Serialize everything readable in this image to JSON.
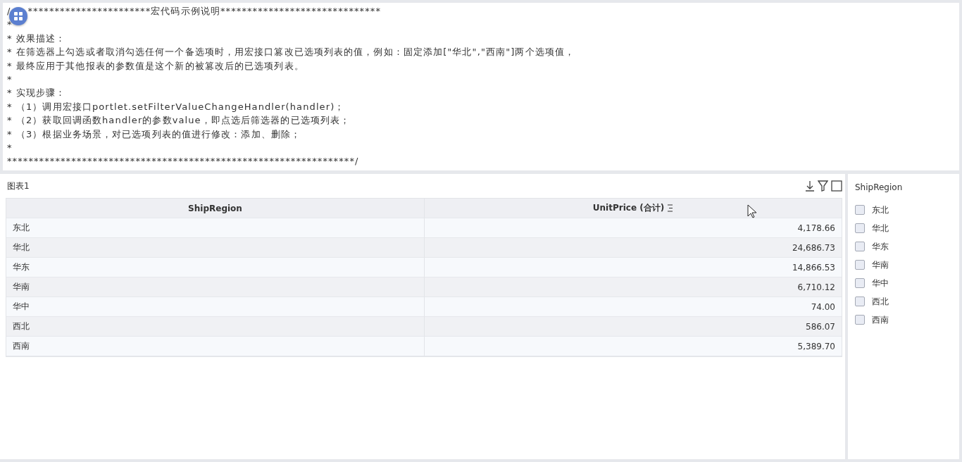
{
  "macro_description": {
    "first_line_start": "/",
    "first_line_rest": "***********************宏代码示例说明******************************",
    "lines": [
      "*",
      "* 效果描述：",
      "* 在筛选器上勾选或者取消勾选任何一个备选项时，用宏接口篡改已选项列表的值，例如：固定添加[\"华北\",\"西南\"]两个选项值，",
      "* 最终应用于其他报表的参数值是这个新的被篡改后的已选项列表。",
      "*",
      "* 实现步骤：",
      "* （1）调用宏接口portlet.setFilterValueChangeHandler(handler)；",
      "* （2）获取回调函数handler的参数value，即点选后筛选器的已选项列表；",
      "* （3）根据业务场景，对已选项列表的值进行修改：添加、删除；",
      "*",
      "*****************************************************************/"
    ]
  },
  "chart": {
    "title": "图表1",
    "columns": [
      "ShipRegion",
      "UnitPrice (合计)"
    ],
    "rows": [
      [
        "东北",
        "4,178.66"
      ],
      [
        "华北",
        "24,686.73"
      ],
      [
        "华东",
        "14,866.53"
      ],
      [
        "华南",
        "6,710.12"
      ],
      [
        "华中",
        "74.00"
      ],
      [
        "西北",
        "586.07"
      ],
      [
        "西南",
        "5,389.70"
      ]
    ]
  },
  "filter": {
    "title": "ShipRegion",
    "options": [
      {
        "label": "东北",
        "checked": false
      },
      {
        "label": "华北",
        "checked": false
      },
      {
        "label": "华东",
        "checked": false
      },
      {
        "label": "华南",
        "checked": false
      },
      {
        "label": "华中",
        "checked": false
      },
      {
        "label": "西北",
        "checked": false
      },
      {
        "label": "西南",
        "checked": false
      }
    ]
  }
}
